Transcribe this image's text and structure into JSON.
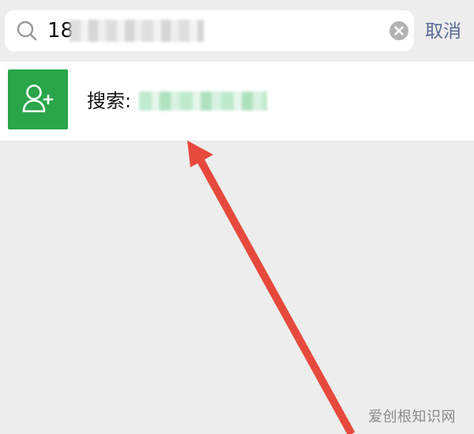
{
  "search": {
    "value": "18",
    "cancel_label": "取消"
  },
  "result": {
    "label": "搜索:"
  },
  "watermark": {
    "text": "爱创根知识网"
  },
  "colors": {
    "accent_green": "#2aa54a",
    "link_blue": "#576b95",
    "annotation_red": "#e64a3c",
    "background": "#ededed"
  },
  "icons": {
    "search": "magnifier-icon",
    "clear": "close-circle-icon",
    "add_contact": "person-add-icon"
  }
}
